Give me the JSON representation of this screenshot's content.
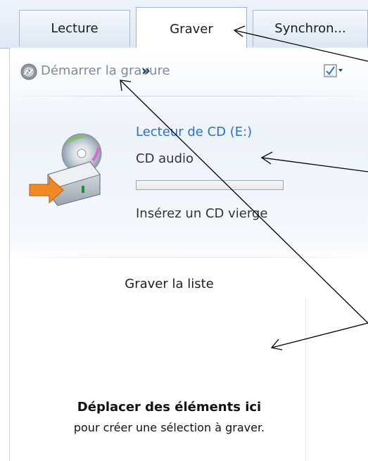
{
  "tabs": [
    {
      "label": "Lecture",
      "active": false
    },
    {
      "label": "Graver",
      "active": true
    },
    {
      "label": "Synchron...",
      "active": false
    }
  ],
  "toolbar": {
    "start_burn_label": "Démarrer la gravure",
    "more_label": "»",
    "start_burn_icon": "disc-burn-icon",
    "options_icon": "list-options-icon"
  },
  "drive": {
    "name": "Lecteur de CD (E:)",
    "disc_type": "CD audio",
    "progress_percent": 0,
    "status": "Insérez un CD vierge",
    "icon": "cd-drive-icon"
  },
  "burn_list": {
    "title": "Graver la liste",
    "drop_title": "Déplacer des éléments ici",
    "drop_subtitle": "pour créer une sélection à graver."
  },
  "colors": {
    "accent_link": "#2a6ed1",
    "disabled_text": "#7f8b99",
    "annotation_arrow": "#000000"
  }
}
